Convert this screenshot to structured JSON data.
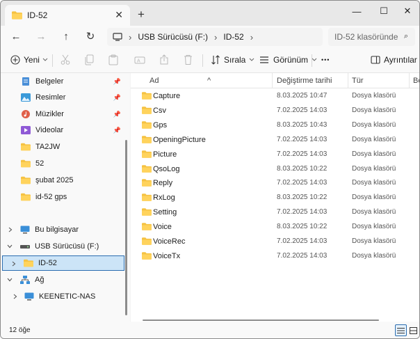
{
  "window": {
    "tab_title": "ID-52",
    "close_tab": "✕",
    "new_tab": "+",
    "minimize": "—",
    "maximize": "☐",
    "close": "✕"
  },
  "nav": {
    "back": "←",
    "forward": "→",
    "up": "↑",
    "refresh": "↻"
  },
  "address": {
    "crumbs": [
      "USB Sürücüsü (F:)",
      "ID-52"
    ],
    "sep": "›",
    "search_placeholder": "ID-52 klasöründe",
    "search_icon": "⌕"
  },
  "toolbar": {
    "new_label": "Yeni",
    "sort_label": "Sırala",
    "view_label": "Görünüm",
    "more_label": "•••",
    "details_label": "Ayrıntılar"
  },
  "sidebar": {
    "pinned": [
      {
        "label": "Belgeler",
        "icon": "documents-icon"
      },
      {
        "label": "Resimler",
        "icon": "pictures-icon"
      },
      {
        "label": "Müzikler",
        "icon": "music-icon"
      },
      {
        "label": "Videolar",
        "icon": "videos-icon"
      }
    ],
    "folders": [
      "TA2JW",
      "52",
      "şubat 2025",
      "id-52 gps"
    ],
    "this_pc": "Bu bilgisayar",
    "usb": "USB Sürücüsü (F:)",
    "id52": "ID-52",
    "network": "Ağ",
    "nas": "KEENETIC-NAS"
  },
  "columns": {
    "name": "Ad",
    "modified": "Değiştirme tarihi",
    "type": "Tür",
    "size": "Bo"
  },
  "files": [
    {
      "name": "Capture",
      "date": "8.03.2025 10:47",
      "type": "Dosya klasörü"
    },
    {
      "name": "Csv",
      "date": "7.02.2025 14:03",
      "type": "Dosya klasörü"
    },
    {
      "name": "Gps",
      "date": "8.03.2025 10:43",
      "type": "Dosya klasörü"
    },
    {
      "name": "OpeningPicture",
      "date": "7.02.2025 14:03",
      "type": "Dosya klasörü"
    },
    {
      "name": "Picture",
      "date": "7.02.2025 14:03",
      "type": "Dosya klasörü"
    },
    {
      "name": "QsoLog",
      "date": "8.03.2025 10:22",
      "type": "Dosya klasörü"
    },
    {
      "name": "Reply",
      "date": "7.02.2025 14:03",
      "type": "Dosya klasörü"
    },
    {
      "name": "RxLog",
      "date": "8.03.2025 10:22",
      "type": "Dosya klasörü"
    },
    {
      "name": "Setting",
      "date": "7.02.2025 14:03",
      "type": "Dosya klasörü"
    },
    {
      "name": "Voice",
      "date": "8.03.2025 10:22",
      "type": "Dosya klasörü"
    },
    {
      "name": "VoiceRec",
      "date": "7.02.2025 14:03",
      "type": "Dosya klasörü"
    },
    {
      "name": "VoiceTx",
      "date": "7.02.2025 14:03",
      "type": "Dosya klasörü"
    }
  ],
  "status": {
    "count": "12 öğe"
  },
  "colors": {
    "folder": "#f5c242",
    "folder_dark": "#e0a82a",
    "selection": "#cce4f7",
    "accent": "#2b6db0"
  }
}
